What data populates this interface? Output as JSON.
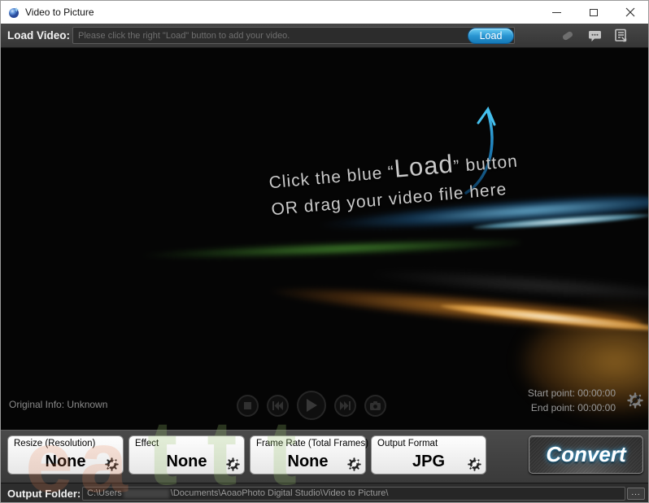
{
  "titlebar": {
    "title": "Video to Picture"
  },
  "load_bar": {
    "label": "Load Video:",
    "placeholder": "Please click the right \"Load\" button to add your video.",
    "load_button": "Load"
  },
  "preview_hint": {
    "line1_prefix": "Click the blue “",
    "line1_load": "Load",
    "line1_suffix": "” button",
    "line2": "OR drag your video file here"
  },
  "player": {
    "original_info": "Original Info: Unknown",
    "start_point": "Start point: 00:00:00",
    "end_point": "End point: 00:00:00"
  },
  "options": [
    {
      "label": "Resize (Resolution)",
      "value": "None"
    },
    {
      "label": "Effect",
      "value": "None"
    },
    {
      "label": "Frame Rate (Total Frames)",
      "value": "None"
    },
    {
      "label": "Output Format",
      "value": "JPG"
    }
  ],
  "convert": {
    "label": "Convert"
  },
  "output_folder": {
    "label": "Output Folder:",
    "path_prefix": "C:\\Users",
    "path_suffix": "\\Documents\\AoaoPhoto Digital Studio\\Video to Picture\\",
    "browse_label": "..."
  },
  "watermark": {
    "orange": "ea",
    "green": "ttt"
  },
  "colors": {
    "load_button_blue": "#1e8ac8",
    "convert_glow": "#3fa9e0",
    "streak_blue": "#4ab4e6",
    "streak_green": "#4a9a3a",
    "streak_orange": "#e8982f"
  }
}
